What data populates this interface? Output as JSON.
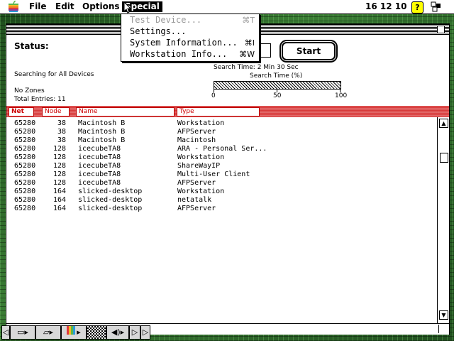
{
  "menubar": {
    "apple": "",
    "menus": [
      "File",
      "Edit",
      "Options",
      "Special"
    ],
    "clock": "16 12 10"
  },
  "special_menu": {
    "items": [
      {
        "label": "Test Device...",
        "shortcut": "⌘T",
        "enabled": false
      },
      {
        "label": "Settings...",
        "shortcut": "",
        "enabled": true
      },
      {
        "label": "System Information...",
        "shortcut": "⌘I",
        "enabled": true
      },
      {
        "label": "Workstation Info...",
        "shortcut": "⌘W",
        "enabled": true
      }
    ]
  },
  "window": {
    "status_label": "Status:",
    "start_button": "Start",
    "searching_text": "Searching for All Devices",
    "zones_text": "No Zones",
    "total_entries": "Total Entries: 11",
    "search_time": "Search Time: 2 Min  30 Sec",
    "search_time_pct_label": "Search Time (%)",
    "progress_value": 1.0,
    "scale": [
      "0",
      "50",
      "100"
    ]
  },
  "table": {
    "columns": [
      "Net",
      "Node",
      "Name",
      "Type"
    ],
    "rows": [
      [
        "65280",
        "38",
        "Macintosh B",
        "Workstation"
      ],
      [
        "65280",
        "38",
        "Macintosh B",
        "AFPServer"
      ],
      [
        "65280",
        "38",
        "Macintosh B",
        "  Macintosh"
      ],
      [
        "65280",
        "128",
        "icecubeTA8",
        "ARA - Personal Ser..."
      ],
      [
        "65280",
        "128",
        "icecubeTA8",
        "Workstation"
      ],
      [
        "65280",
        "128",
        "icecubeTA8",
        "ShareWayIP"
      ],
      [
        "65280",
        "128",
        "icecubeTA8",
        "Multi-User Client"
      ],
      [
        "65280",
        "128",
        "icecubeTA8",
        "AFPServer"
      ],
      [
        "65280",
        "164",
        "slicked-desktop",
        "Workstation"
      ],
      [
        "65280",
        "164",
        "slicked-desktop",
        "netatalk"
      ],
      [
        "65280",
        "164",
        "slicked-desktop",
        "AFPServer"
      ]
    ]
  },
  "icons": {
    "apple": "apple-logo-icon",
    "help": "help-icon",
    "app": "application-icon",
    "control_strip": [
      "monitor-icon",
      "folder-icon",
      "color-depth-icon",
      "resolution-icon",
      "sound-icon",
      "expand-arrow-icon"
    ]
  },
  "colors": {
    "header_red": "#d83a3a",
    "desktop_green": "#2e6b2a"
  }
}
